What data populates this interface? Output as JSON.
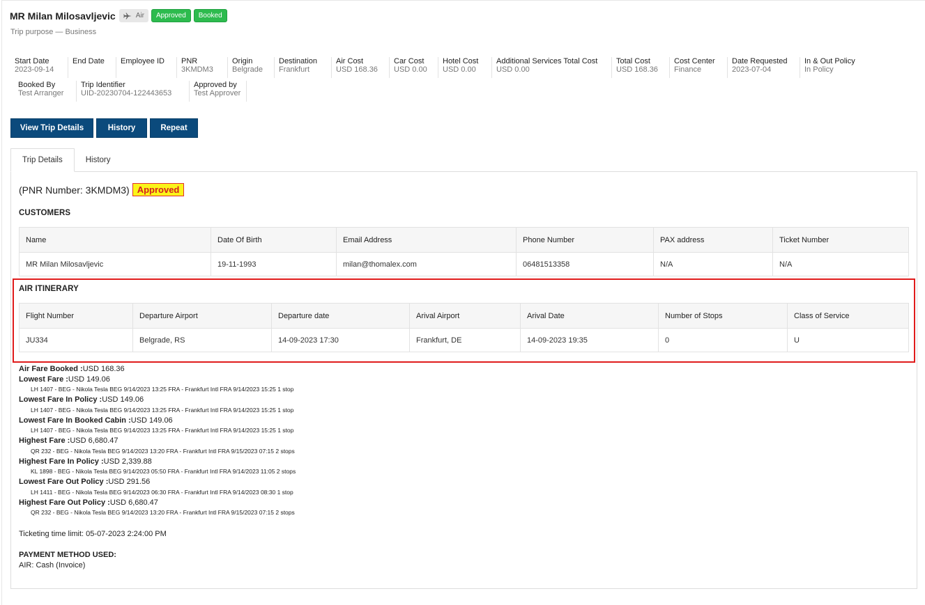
{
  "header": {
    "title": "MR Milan Milosavljevic",
    "tags": {
      "air": "Air",
      "approved": "Approved",
      "booked": "Booked"
    },
    "subtitle": "Trip purpose — Business"
  },
  "summary": {
    "row1": [
      {
        "label": "Start Date",
        "value": "2023-09-14"
      },
      {
        "label": "End Date",
        "value": ""
      },
      {
        "label": "Employee ID",
        "value": ""
      },
      {
        "label": "PNR",
        "value": "3KMDM3"
      },
      {
        "label": "Origin",
        "value": "Belgrade"
      },
      {
        "label": "Destination",
        "value": "Frankfurt"
      },
      {
        "label": "Air Cost",
        "value": "USD 168.36"
      },
      {
        "label": "Car Cost",
        "value": "USD 0.00"
      },
      {
        "label": "Hotel Cost",
        "value": "USD 0.00"
      },
      {
        "label": "Additional Services Total Cost",
        "value": "USD 0.00"
      },
      {
        "label": "Total Cost",
        "value": "USD 168.36"
      },
      {
        "label": "Cost Center",
        "value": "Finance"
      },
      {
        "label": "Date Requested",
        "value": "2023-07-04"
      },
      {
        "label": "In & Out Policy",
        "value": "In Policy"
      }
    ],
    "row2": [
      {
        "label": "Booked By",
        "value": "Test Arranger"
      },
      {
        "label": "Trip Identifier",
        "value": "UID-20230704-122443653"
      },
      {
        "label": "Approved by",
        "value": "Test Approver"
      }
    ]
  },
  "buttons": {
    "view": "View Trip Details",
    "history": "History",
    "repeat": "Repeat"
  },
  "tabs": {
    "trip": "Trip Details",
    "history": "History"
  },
  "pnr": {
    "text": "(PNR Number: 3KMDM3)",
    "status": "Approved"
  },
  "customers": {
    "title": "CUSTOMERS",
    "headers": [
      "Name",
      "Date Of Birth",
      "Email Address",
      "Phone Number",
      "PAX address",
      "Ticket Number"
    ],
    "rows": [
      [
        "MR Milan Milosavljevic",
        "19-11-1993",
        "milan@thomalex.com",
        "06481513358",
        "N/A",
        "N/A"
      ]
    ]
  },
  "air": {
    "title": "AIR ITINERARY",
    "headers": [
      "Flight Number",
      "Departure Airport",
      "Departure date",
      "Arival Airport",
      "Arival Date",
      "Number of Stops",
      "Class of Service"
    ],
    "rows": [
      [
        "JU334",
        "Belgrade, RS",
        "14-09-2023 17:30",
        "Frankfurt, DE",
        "14-09-2023 19:35",
        "0",
        "U"
      ]
    ]
  },
  "fares": {
    "booked": {
      "label": "Air Fare Booked :",
      "value": "USD 168.36"
    },
    "items": [
      {
        "label": "Lowest Fare :",
        "value": "USD 149.06",
        "detail": "LH 1407 - BEG - Nikola Tesla BEG 9/14/2023 13:25 FRA - Frankfurt Intl FRA 9/14/2023 15:25 1 stop"
      },
      {
        "label": "Lowest Fare In Policy :",
        "value": "USD 149.06",
        "detail": "LH 1407 - BEG - Nikola Tesla BEG 9/14/2023 13:25 FRA - Frankfurt Intl FRA 9/14/2023 15:25 1 stop"
      },
      {
        "label": "Lowest Fare In Booked Cabin :",
        "value": "USD 149.06",
        "detail": "LH 1407 - BEG - Nikola Tesla BEG 9/14/2023 13:25 FRA - Frankfurt Intl FRA 9/14/2023 15:25 1 stop"
      },
      {
        "label": "Highest Fare :",
        "value": "USD 6,680.47",
        "detail": "QR 232 - BEG - Nikola Tesla BEG 9/14/2023 13:20 FRA - Frankfurt Intl FRA 9/15/2023 07:15 2 stops"
      },
      {
        "label": "Highest Fare In Policy :",
        "value": "USD 2,339.88",
        "detail": "KL 1898 - BEG - Nikola Tesla BEG 9/14/2023 05:50 FRA - Frankfurt Intl FRA 9/14/2023 11:05 2 stops"
      },
      {
        "label": "Lowest Fare Out Policy :",
        "value": "USD 291.56",
        "detail": "LH 1411 - BEG - Nikola Tesla BEG 9/14/2023 06:30 FRA - Frankfurt Intl FRA 9/14/2023 08:30 1 stop"
      },
      {
        "label": "Highest Fare Out Policy :",
        "value": "USD 6,680.47",
        "detail": "QR 232 - BEG - Nikola Tesla BEG 9/14/2023 13:20 FRA - Frankfurt Intl FRA 9/15/2023 07:15 2 stops"
      }
    ]
  },
  "ticketing": "Ticketing time limit: 05-07-2023 2:24:00 PM",
  "payment": {
    "title": "PAYMENT METHOD USED:",
    "value": "AIR: Cash (Invoice)"
  },
  "icons": {
    "air_tag": "airplane-icon"
  },
  "colors": {
    "primary_button": "#0b4a7c",
    "success_tag": "#2dbb4e",
    "highlight_border": "#e01b1b",
    "badge_bg": "#fbf419"
  }
}
